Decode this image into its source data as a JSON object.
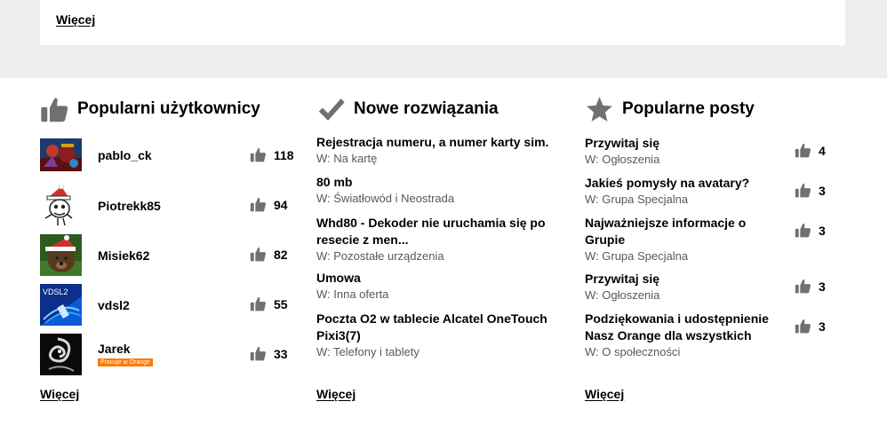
{
  "top": {
    "more_label": "Więcej"
  },
  "users_section": {
    "title": "Popularni użytkownicy",
    "more_label": "Więcej",
    "users": [
      {
        "name": "pablo_ck",
        "kudos": "118",
        "badge": ""
      },
      {
        "name": "Piotrekk85",
        "kudos": "94",
        "badge": ""
      },
      {
        "name": "Misiek62",
        "kudos": "82",
        "badge": ""
      },
      {
        "name": "vdsl2",
        "kudos": "55",
        "badge": ""
      },
      {
        "name": "Jarek",
        "kudos": "33",
        "badge": "Pracuje w Orange"
      }
    ],
    "avatar_texts": {
      "vdsl2": "VDSL2"
    }
  },
  "solutions_section": {
    "title": "Nowe rozwiązania",
    "more_label": "Więcej",
    "items": [
      {
        "title": "Rejestracja numeru, a numer karty sim.",
        "board": "W: Na kartę"
      },
      {
        "title": "80 mb",
        "board": "W: Światłowód i Neostrada"
      },
      {
        "title": "Whd80 - Dekoder nie uruchamia się po resecie z men...",
        "board": "W: Pozostałe urządzenia"
      },
      {
        "title": "Umowa",
        "board": "W: Inna oferta"
      },
      {
        "title": "Poczta O2 w tablecie Alcatel OneTouch Pixi3(7)",
        "board": "W: Telefony i tablety"
      }
    ]
  },
  "posts_section": {
    "title": "Popularne posty",
    "more_label": "Więcej",
    "items": [
      {
        "title": "Przywitaj się",
        "board": "W: Ogłoszenia",
        "kudos": "4"
      },
      {
        "title": "Jakieś pomysły na avatary?",
        "board": "W: Grupa Specjalna",
        "kudos": "3"
      },
      {
        "title": "Najważniejsze informacje o Grupie",
        "board": "W: Grupa Specjalna",
        "kudos": "3"
      },
      {
        "title": "Przywitaj się",
        "board": "W: Ogłoszenia",
        "kudos": "3"
      },
      {
        "title": "Podziękowania i udostępnienie Nasz Orange dla wszystkich",
        "board": "W: O społeczności",
        "kudos": "3"
      }
    ]
  },
  "colors": {
    "page_bg": "#eeeeee",
    "card_bg": "#ffffff",
    "icon_gray": "#707070",
    "badge_orange": "#ff7900",
    "board_text": "#595959"
  },
  "icons": {
    "users_header": "thumbs-up-icon",
    "solutions_header": "checkmark-icon",
    "posts_header": "star-icon",
    "kudos": "thumbs-up-icon"
  }
}
